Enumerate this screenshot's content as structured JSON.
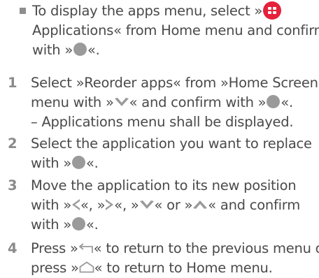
{
  "intro": {
    "line1": "To display the apps menu, select »",
    "line2": "Applications« from Home menu and confirm",
    "line3a": "with »",
    "line3b": "«."
  },
  "steps": [
    {
      "number": "1",
      "l1a": "Select »Reorder apps« from »Home Screen«",
      "l2a": "menu with »",
      "l2b": "« and confirm with »",
      "l2c": "«.",
      "l3": "– Applications menu shall be displayed."
    },
    {
      "number": "2",
      "l1": "Select the application you want to replace",
      "l2a": "with »",
      "l2b": "«."
    },
    {
      "number": "3",
      "l1": "Move the application to its new position",
      "l2a": "with »",
      "l2b": "«, »",
      "l2c": "«, »",
      "l2d": "« or »",
      "l2e": "« and confirm",
      "l3a": "with »",
      "l3b": "«."
    },
    {
      "number": "4",
      "l1a": "Press »",
      "l1b": "« to return to the previous menu or",
      "l2a": "press »",
      "l2b": "« to return to Home menu."
    }
  ],
  "icons": {
    "ok": "ok-button-icon",
    "menu": "home-menu-button-icon",
    "down": "down-arrow-icon",
    "up": "up-arrow-icon",
    "left": "left-arrow-icon",
    "right": "right-arrow-icon",
    "back": "back-icon",
    "home": "home-icon"
  },
  "colors": {
    "text": "#4a4a4a",
    "number": "#8a8a8a",
    "icon": "#9a9a9a",
    "menu_button": "#e5213b"
  }
}
